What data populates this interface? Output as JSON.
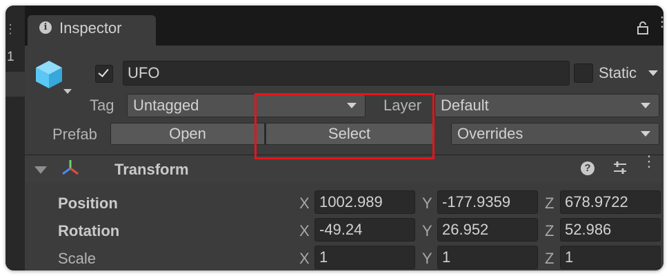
{
  "left_panel": {
    "number": "1"
  },
  "tab": {
    "title": "Inspector"
  },
  "object": {
    "active_checked": true,
    "name": "UFO",
    "static_label": "Static",
    "static_checked": false
  },
  "tag": {
    "label": "Tag",
    "value": "Untagged"
  },
  "layer": {
    "label": "Layer",
    "value": "Default"
  },
  "prefab": {
    "label": "Prefab",
    "open_label": "Open",
    "select_label": "Select",
    "overrides_label": "Overrides"
  },
  "transform": {
    "title": "Transform",
    "rows": [
      {
        "label": "Position",
        "x": "1002.989",
        "y": "-177.9359",
        "z": "678.9722"
      },
      {
        "label": "Rotation",
        "x": "-49.24",
        "y": "26.952",
        "z": "52.986"
      },
      {
        "label": "Scale",
        "x": "1",
        "y": "1",
        "z": "1"
      }
    ]
  },
  "axes": {
    "x": "X",
    "y": "Y",
    "z": "Z"
  },
  "colors": {
    "highlight": "#e8141a",
    "panel": "#3c3c3c",
    "field": "#2a2a2a",
    "cube": "#5bc7f5"
  }
}
